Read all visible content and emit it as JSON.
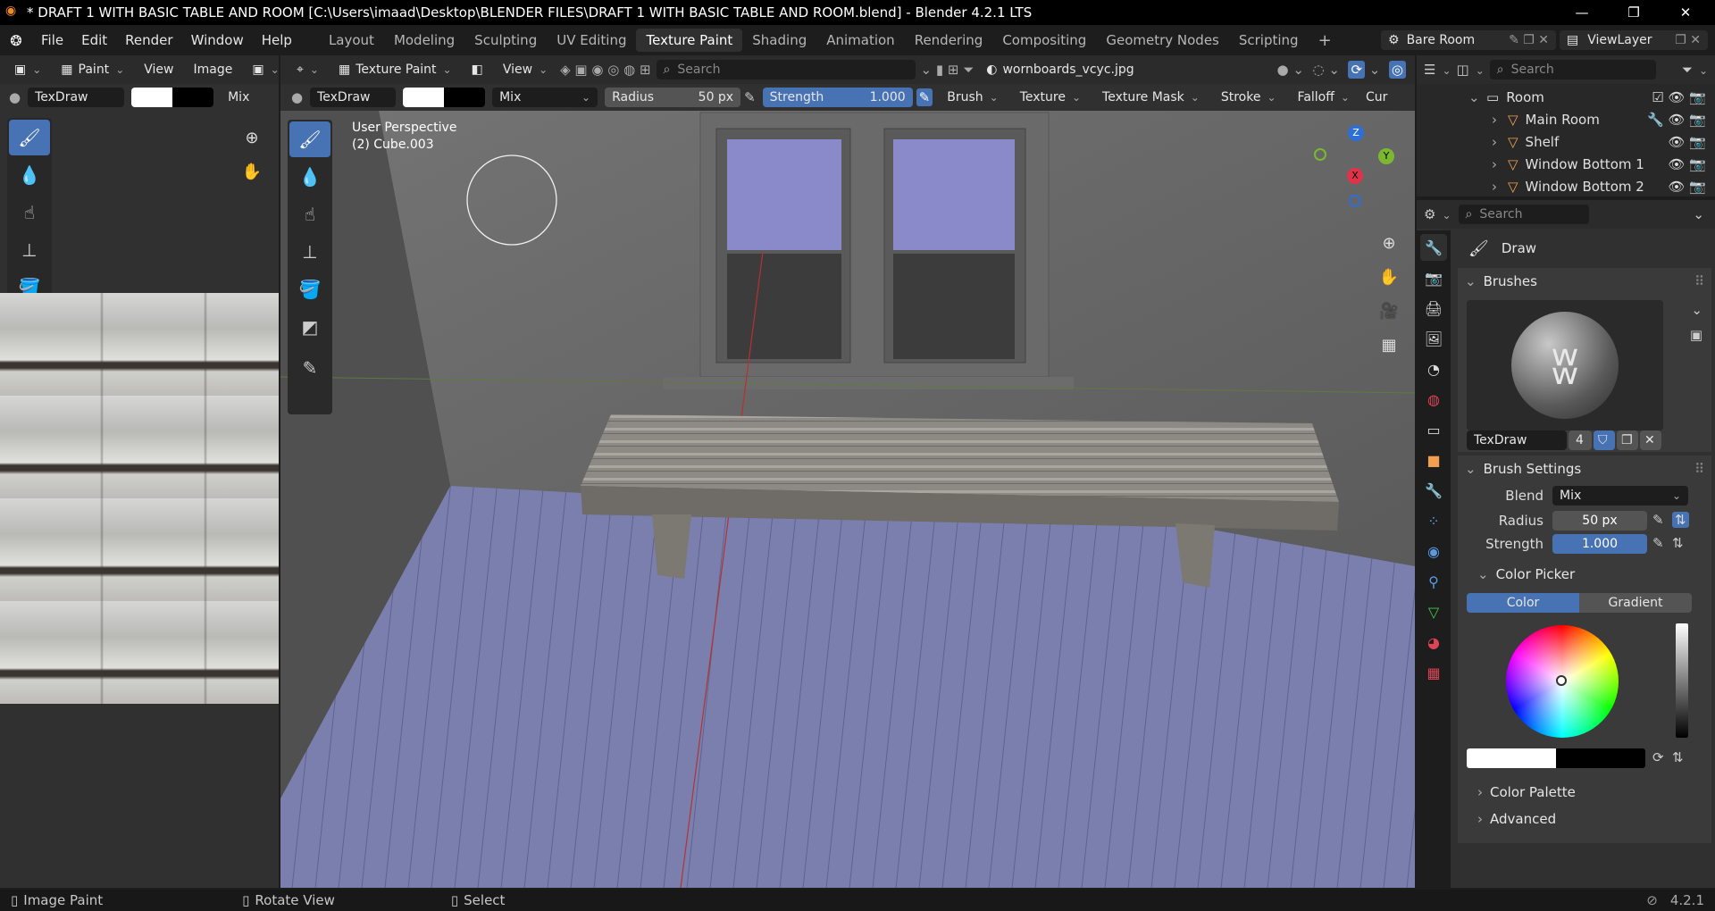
{
  "window": {
    "title": "* DRAFT 1 WITH BASIC TABLE AND ROOM [C:\\Users\\imaad\\Desktop\\BLENDER FILES\\DRAFT 1 WITH BASIC TABLE AND ROOM.blend] - Blender 4.2.1 LTS"
  },
  "menu": [
    "File",
    "Edit",
    "Render",
    "Window",
    "Help"
  ],
  "workspaces": [
    "Layout",
    "Modeling",
    "Sculpting",
    "UV Editing",
    "Texture Paint",
    "Shading",
    "Animation",
    "Rendering",
    "Compositing",
    "Geometry Nodes",
    "Scripting"
  ],
  "scene": {
    "name": "Bare Room",
    "view_layer": "ViewLayer"
  },
  "image_editor": {
    "mode": "Paint",
    "view": "View",
    "image": "Image",
    "brush": "TexDraw",
    "blend": "Mix"
  },
  "viewport": {
    "mode": "Texture Paint",
    "view": "View",
    "search_placeholder": "Search",
    "image_name": "wornboards_vcyc.jpg",
    "perspective": "User Perspective",
    "object": "(2) Cube.003",
    "brush": "TexDraw",
    "blend": "Mix",
    "radius_label": "Radius",
    "radius_value": "50 px",
    "strength_label": "Strength",
    "strength_value": "1.000",
    "menus": [
      "Brush",
      "Texture",
      "Texture Mask",
      "Stroke",
      "Falloff",
      "Cur"
    ],
    "gizmo": {
      "z": "Z",
      "y": "Y",
      "x": "X"
    }
  },
  "outliner": {
    "search_placeholder": "Search",
    "items": [
      "Room",
      "Main Room",
      "Shelf",
      "Window Bottom 1",
      "Window Bottom 2"
    ]
  },
  "properties": {
    "search_placeholder": "Search",
    "tool": "Draw",
    "brushes_header": "Brushes",
    "brush_name": "TexDraw",
    "brush_users": "4",
    "brush_settings_header": "Brush Settings",
    "blend_label": "Blend",
    "blend_value": "Mix",
    "radius_label": "Radius",
    "radius_value": "50 px",
    "strength_label": "Strength",
    "strength_value": "1.000",
    "color_picker_header": "Color Picker",
    "color_tab": "Color",
    "gradient_tab": "Gradient",
    "color_palette": "Color Palette",
    "advanced": "Advanced"
  },
  "status": {
    "left": "Image Paint",
    "middle": "Rotate View",
    "right": "Select",
    "version": "4.2.1"
  },
  "colors": {
    "accent": "#4772b3",
    "active_tool": "#4772b3",
    "floor": "#7b7fae",
    "window_glass": "#8a89c9"
  }
}
